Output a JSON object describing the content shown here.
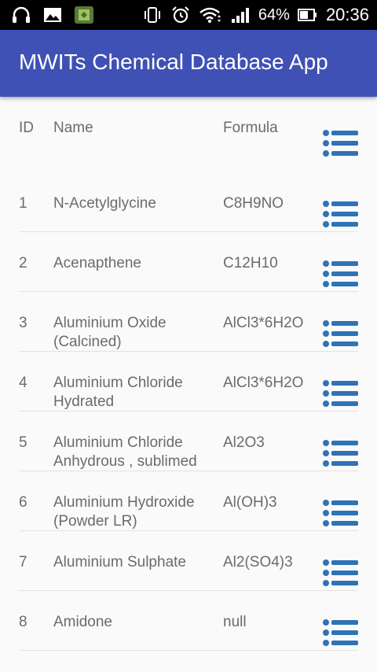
{
  "status_bar": {
    "battery_percent": "64%",
    "time": "20:36",
    "icons": [
      "headset-icon",
      "image-icon",
      "app-notification-icon",
      "vibrate-icon",
      "alarm-icon",
      "wifi-icon",
      "signal-icon",
      "battery-icon"
    ]
  },
  "app_bar": {
    "title": "MWITs Chemical Database App",
    "color": "#3f51b5"
  },
  "table": {
    "headers": {
      "id": "ID",
      "name": "Name",
      "formula": "Formula"
    },
    "rows": [
      {
        "id": "1",
        "name": "N-Acetylglycine",
        "formula": "C8H9NO"
      },
      {
        "id": "2",
        "name": "Acenapthene",
        "formula": "C12H10"
      },
      {
        "id": "3",
        "name": "Aluminium Oxide (Calcined)",
        "formula": "AlCl3*6H2O"
      },
      {
        "id": "4",
        "name": "Aluminium Chloride Hydrated",
        "formula": "AlCl3*6H2O"
      },
      {
        "id": "5",
        "name": "Aluminium Chloride Anhydrous , sublimed",
        "formula": "Al2O3"
      },
      {
        "id": "6",
        "name": "Aluminium Hydroxide (Powder LR)",
        "formula": "Al(OH)3"
      },
      {
        "id": "7",
        "name": "Aluminium Sulphate",
        "formula": "Al2(SO4)3"
      },
      {
        "id": "8",
        "name": "Amidone",
        "formula": "null"
      }
    ],
    "action_icon": "list-icon",
    "action_color": "#2f73b5"
  }
}
